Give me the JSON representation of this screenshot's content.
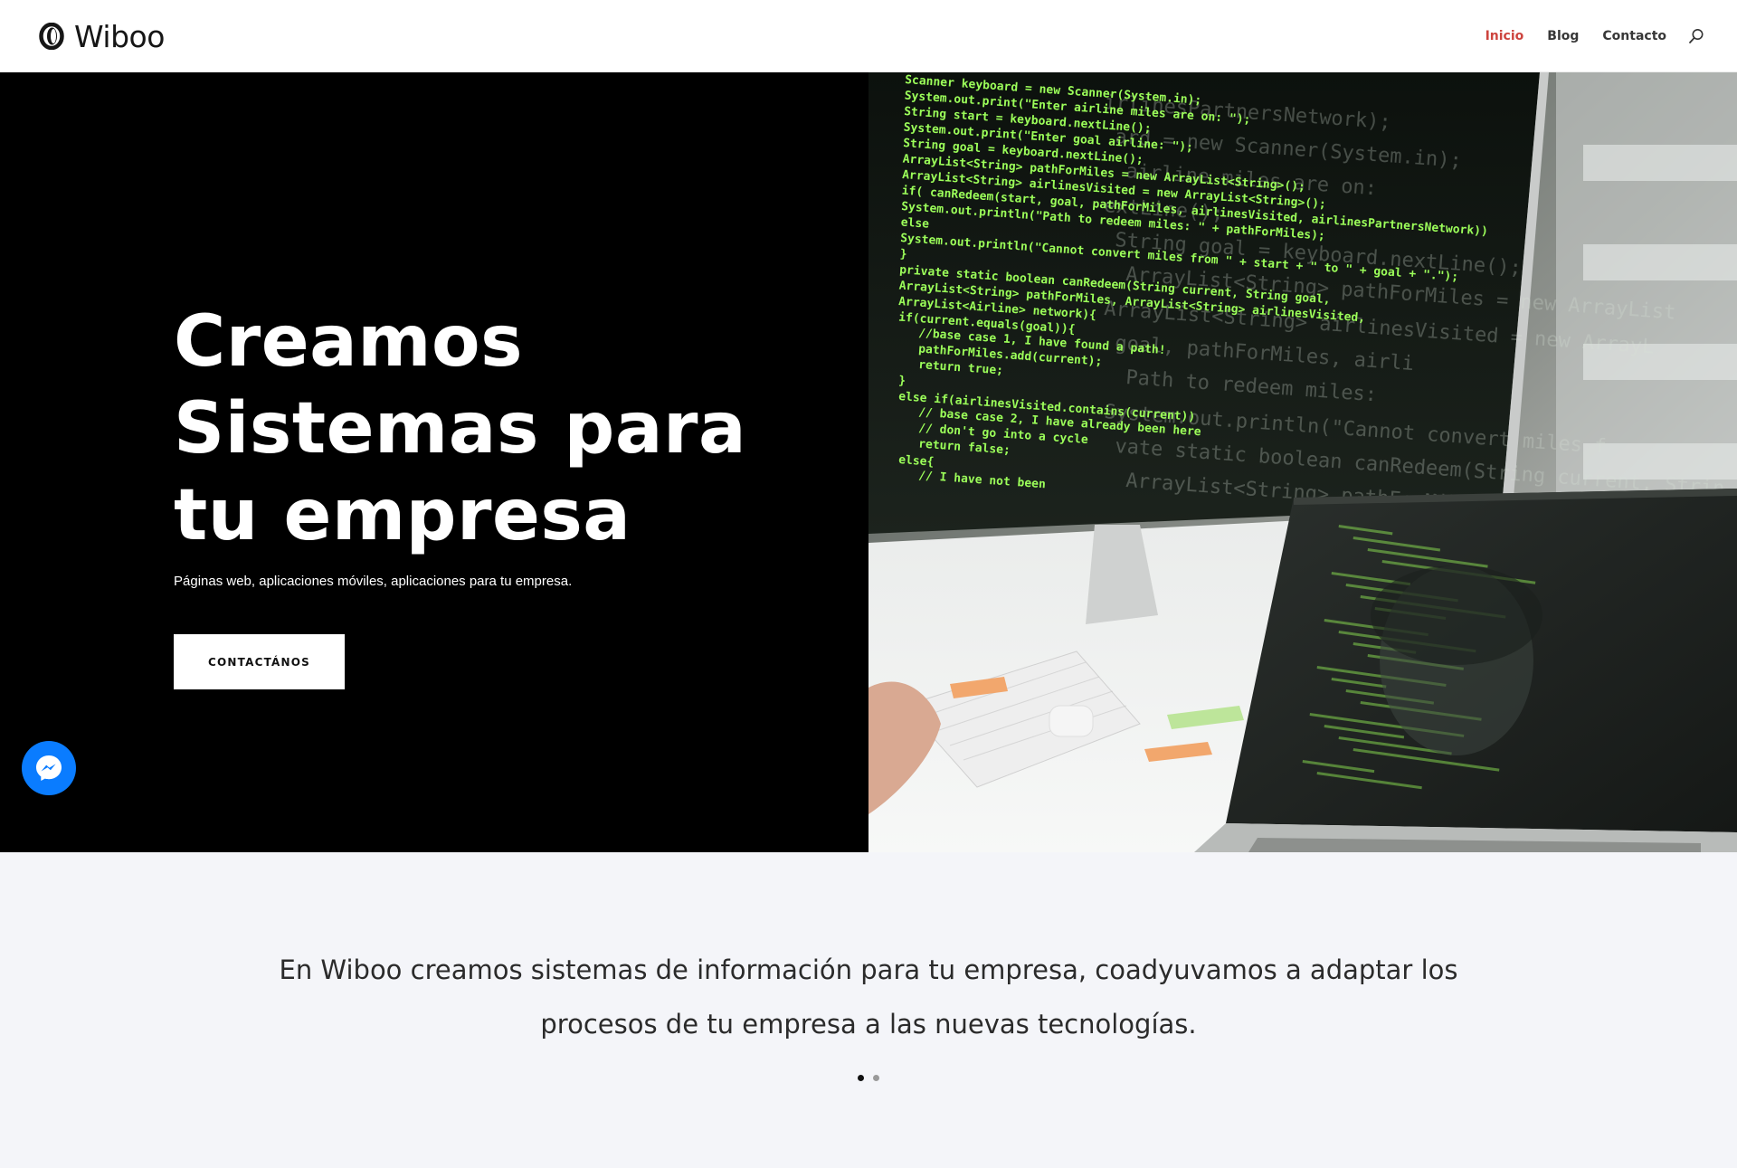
{
  "header": {
    "brand": "Wiboo",
    "logo_icon": "wiboo-logo-icon",
    "nav": [
      {
        "label": "Inicio",
        "active": true
      },
      {
        "label": "Blog",
        "active": false
      },
      {
        "label": "Contacto",
        "active": false
      }
    ],
    "search_icon": "search-icon"
  },
  "hero": {
    "title_lines": [
      "Creamos",
      "Sistemas para",
      "tu empresa"
    ],
    "subtitle": "Páginas web, aplicaciones móviles, aplicaciones para tu empresa.",
    "cta_label": "CONTACTÁNOS",
    "image": "developer-screens-photo"
  },
  "messenger": {
    "icon": "messenger-icon"
  },
  "intro": {
    "text": "En Wiboo creamos sistemas de información para tu empresa, coadyuvamos a adaptar los procesos de tu empresa a las nuevas tecnologías.",
    "slides": 2,
    "active_slide": 1
  },
  "colors": {
    "accent": "#c8302a",
    "hero_bg": "#000000",
    "intro_bg": "#f4f5f9",
    "messenger": "#0a7cff",
    "code_green": "#9cff5a"
  },
  "photo": {
    "code_lines": [
      "Scanner keyboard = new Scanner(System.in);",
      "System.out.print(\"Enter airline miles are on: \");",
      "String start = keyboard.nextLine();",
      "System.out.print(\"Enter goal airline: \");",
      "String goal = keyboard.nextLine();",
      "ArrayList<String> pathForMiles = new ArrayList<String>();",
      "ArrayList<String> airlinesVisited = new ArrayList<String>();",
      "if( canRedeem(start, goal, pathForMiles, airlinesVisited, airlinesPartnersNetwork))",
      "System.out.println(\"Path to redeem miles: \" + pathForMiles);",
      "else",
      "System.out.println(\"Cannot convert miles from \" + start + \" to \" + goal + \".\");",
      "}",
      "private static boolean canRedeem(String current, String goal,",
      "ArrayList<String> pathForMiles, ArrayList<String> airlinesVisited,",
      "ArrayList<Airline> network){",
      "if(current.equals(goal)){",
      "//base case 1, I have found a path!",
      "pathForMiles.add(current);",
      "return true;",
      "}",
      "else if(airlinesVisited.contains(current))",
      "// base case 2, I have already been here",
      "// don't go into a cycle",
      "return false;",
      "else{",
      "// I have not been"
    ],
    "ghost_lines": [
      "irlinesPartnersNetwork);",
      "ard = new Scanner(System.in);",
      "airline miles are on:",
      "extLine();",
      "String goal = keyboard.nextLine();",
      "ArrayList<String> pathForMiles = new ArrayList",
      "ArrayList<String> airlinesVisited = new ArrayL",
      "goal, pathForMiles, airli",
      "Path to redeem miles:",
      "System.out.println(\"Cannot convert miles f",
      "vate static boolean canRedeem(String current, Strin",
      "ArrayList<String> pathForMiles,"
    ]
  }
}
